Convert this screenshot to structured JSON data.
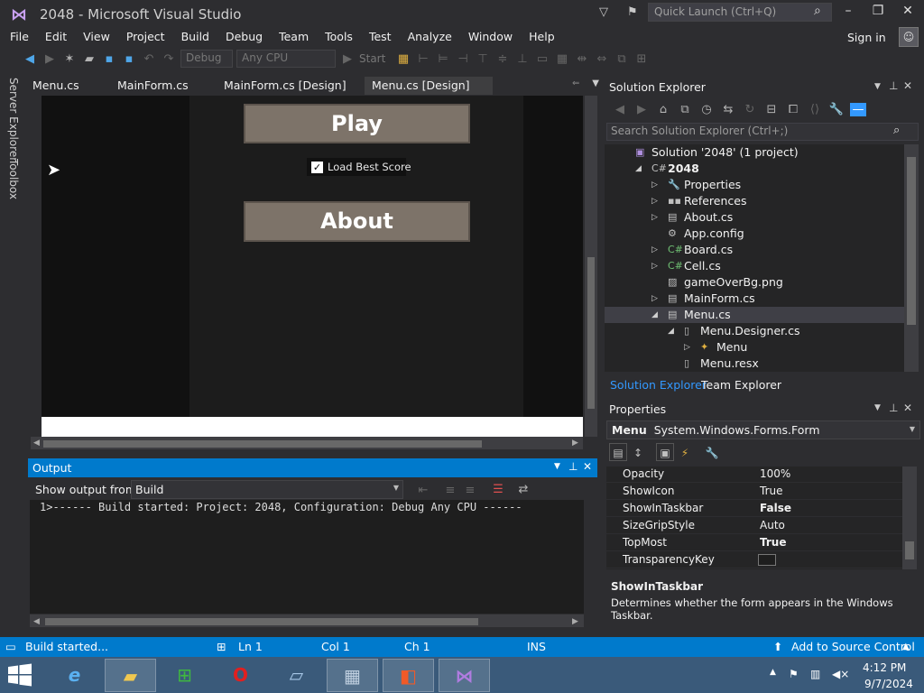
{
  "window": {
    "title": "2048 - Microsoft Visual Studio",
    "quick_launch_placeholder": "Quick Launch (Ctrl+Q)",
    "minimize": "–",
    "maximize": "❐",
    "close": "✕"
  },
  "menu": [
    "File",
    "Edit",
    "View",
    "Project",
    "Build",
    "Debug",
    "Team",
    "Tools",
    "Test",
    "Analyze",
    "Window",
    "Help"
  ],
  "sign_in": "Sign in",
  "toolbar": {
    "config": "Debug",
    "platform": "Any CPU",
    "start": "Start"
  },
  "left_rail": [
    "Server Explorer",
    "Toolbox"
  ],
  "doc_tabs": [
    "Menu.cs",
    "MainForm.cs",
    "MainForm.cs [Design]",
    "Menu.cs [Design]"
  ],
  "designer": {
    "play_button": "Play",
    "about_button": "About",
    "checkbox_label": "Load Best Score",
    "checkbox_mark": "✓"
  },
  "output": {
    "title": "Output",
    "show_label": "Show output from:",
    "source": "Build",
    "line": "1>------ Build started: Project: 2048, Configuration: Debug Any CPU ------"
  },
  "solution_explorer": {
    "title": "Solution Explorer",
    "search_placeholder": "Search Solution Explorer (Ctrl+;)",
    "items": [
      {
        "label": "Solution '2048' (1 project)",
        "icon": "▣",
        "icon_color": "#b090e0",
        "indent": 0,
        "arrow": ""
      },
      {
        "label": "2048",
        "icon": "C#",
        "icon_color": "#c0c0c0",
        "indent": 1,
        "arrow": "◢",
        "bold": true
      },
      {
        "label": "Properties",
        "icon": "🔧",
        "icon_color": "#c0c0c0",
        "indent": 2,
        "arrow": "▷"
      },
      {
        "label": "References",
        "icon": "▪▪",
        "icon_color": "#c0c0c0",
        "indent": 2,
        "arrow": "▷"
      },
      {
        "label": "About.cs",
        "icon": "▤",
        "icon_color": "#c0c0c0",
        "indent": 2,
        "arrow": "▷"
      },
      {
        "label": "App.config",
        "icon": "⚙",
        "icon_color": "#c0c0c0",
        "indent": 2,
        "arrow": ""
      },
      {
        "label": "Board.cs",
        "icon": "C#",
        "icon_color": "#6fbf73",
        "indent": 2,
        "arrow": "▷"
      },
      {
        "label": "Cell.cs",
        "icon": "C#",
        "icon_color": "#6fbf73",
        "indent": 2,
        "arrow": "▷"
      },
      {
        "label": "gameOverBg.png",
        "icon": "▨",
        "icon_color": "#c0c0c0",
        "indent": 2,
        "arrow": ""
      },
      {
        "label": "MainForm.cs",
        "icon": "▤",
        "icon_color": "#c0c0c0",
        "indent": 2,
        "arrow": "▷"
      },
      {
        "label": "Menu.cs",
        "icon": "▤",
        "icon_color": "#c0c0c0",
        "indent": 2,
        "arrow": "◢",
        "selected": true
      },
      {
        "label": "Menu.Designer.cs",
        "icon": "▯",
        "icon_color": "#c0c0c0",
        "indent": 3,
        "arrow": "◢"
      },
      {
        "label": "Menu",
        "icon": "✦",
        "icon_color": "#e0b040",
        "indent": 4,
        "arrow": "▷"
      },
      {
        "label": "Menu.resx",
        "icon": "▯",
        "icon_color": "#c0c0c0",
        "indent": 3,
        "arrow": ""
      }
    ],
    "tabs": [
      "Solution Explorer",
      "Team Explorer"
    ]
  },
  "properties": {
    "title": "Properties",
    "object_name": "Menu",
    "object_type": "System.Windows.Forms.Form",
    "rows": [
      {
        "name": "Opacity",
        "value": "100%",
        "bold": false
      },
      {
        "name": "ShowIcon",
        "value": "True",
        "bold": false
      },
      {
        "name": "ShowInTaskbar",
        "value": "False",
        "bold": true
      },
      {
        "name": "SizeGripStyle",
        "value": "Auto",
        "bold": false
      },
      {
        "name": "TopMost",
        "value": "True",
        "bold": true
      },
      {
        "name": "TransparencyKey",
        "value": "",
        "bold": false,
        "swatch": true
      }
    ],
    "desc_title": "ShowInTaskbar",
    "desc_text": "Determines whether the form appears in the Windows Taskbar."
  },
  "status": {
    "message": "Build started...",
    "ln": "Ln 1",
    "col": "Col 1",
    "ch": "Ch 1",
    "ins": "INS",
    "source_control": "Add to Source Control"
  },
  "clock": {
    "time": "4:12 PM",
    "date": "9/7/2024"
  },
  "colors": {
    "accent": "#007acc",
    "background": "#2d2d30",
    "form_button": "#7d7369"
  }
}
